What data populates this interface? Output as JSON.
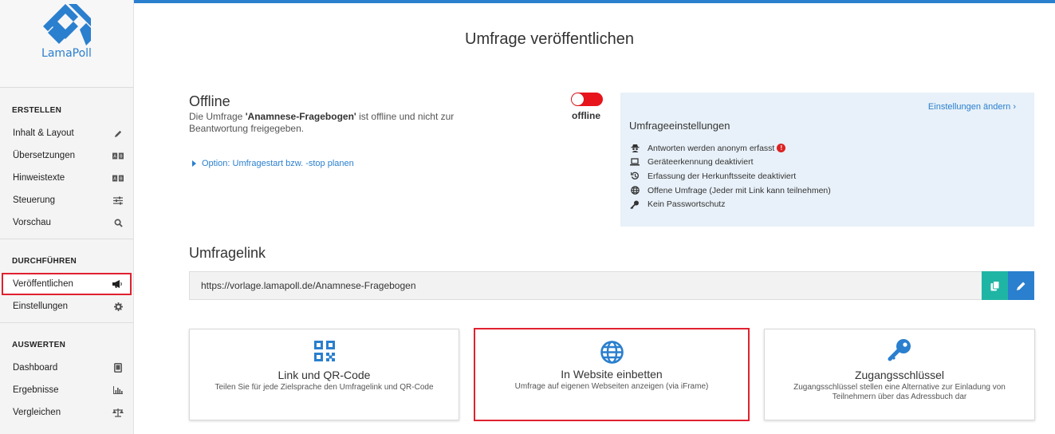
{
  "app": {
    "logo_text": "LamaPoll"
  },
  "sidebar": {
    "sections": [
      {
        "title": "ERSTELLEN",
        "items": [
          {
            "label": "Inhalt & Layout",
            "icon": "pencil-icon"
          },
          {
            "label": "Übersetzungen",
            "icon": "translate-icon"
          },
          {
            "label": "Hinweistexte",
            "icon": "translate-icon"
          },
          {
            "label": "Steuerung",
            "icon": "sliders-icon"
          },
          {
            "label": "Vorschau",
            "icon": "search-icon"
          }
        ]
      },
      {
        "title": "DURCHFÜHREN",
        "items": [
          {
            "label": "Veröffentlichen",
            "icon": "megaphone-icon",
            "active": true
          },
          {
            "label": "Einstellungen",
            "icon": "gear-icon"
          }
        ]
      },
      {
        "title": "AUSWERTEN",
        "items": [
          {
            "label": "Dashboard",
            "icon": "tablet-icon"
          },
          {
            "label": "Ergebnisse",
            "icon": "bar-chart-icon"
          },
          {
            "label": "Vergleichen",
            "icon": "scale-icon"
          }
        ]
      }
    ]
  },
  "main": {
    "title": "Umfrage veröffentlichen",
    "status": {
      "heading": "Offline",
      "desc_prefix": "Die Umfrage ",
      "survey_name": "'Anamnese-Fragebogen'",
      "desc_suffix": " ist offline und nicht zur Beantwortung freigegeben.",
      "toggle_label": "offline",
      "toggle_on": false,
      "schedule_link": "Option: Umfragestart bzw. -stop planen"
    },
    "settings": {
      "change_link": "Einstellungen ändern ›",
      "title": "Umfrageeinstellungen",
      "items": [
        {
          "label": "Antworten werden anonym erfasst",
          "icon": "spy-icon",
          "warning": "!"
        },
        {
          "label": "Geräteerkennung deaktiviert",
          "icon": "laptop-icon"
        },
        {
          "label": "Erfassung der Herkunftsseite deaktiviert",
          "icon": "history-icon"
        },
        {
          "label": "Offene Umfrage (Jeder mit Link kann teilnehmen)",
          "icon": "globe-icon"
        },
        {
          "label": "Kein Passwortschutz",
          "icon": "key-icon"
        }
      ]
    },
    "link": {
      "heading": "Umfragelink",
      "url": "https://vorlage.lamapoll.de/Anamnese-Fragebogen"
    },
    "cards": [
      {
        "title": "Link und QR-Code",
        "subtitle": "Teilen Sie für jede Zielsprache den Umfragelink und QR-Code",
        "icon": "qr-code-icon"
      },
      {
        "title": "In Website einbetten",
        "subtitle": "Umfrage auf eigenen Webseiten anzeigen (via iFrame)",
        "icon": "globe-icon",
        "selected": true
      },
      {
        "title": "Zugangsschlüssel",
        "subtitle": "Zugangsschlüssel stellen eine Alternative zur Einladung von Teilnehmern über das Adressbuch dar",
        "icon": "key-icon"
      }
    ],
    "colors": {
      "accent": "#2a7fce",
      "danger": "#e8141c",
      "teal": "#1fb5a4",
      "highlight": "#e0212f",
      "panel": "#e8f1f9"
    }
  }
}
